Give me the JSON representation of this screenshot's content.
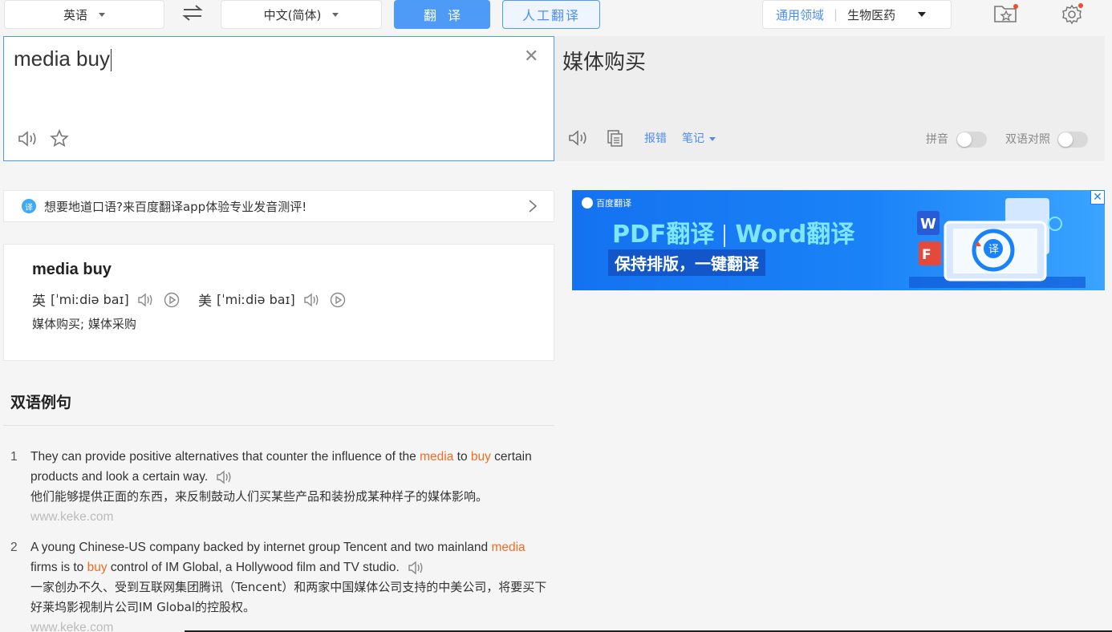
{
  "top_bar": {
    "source_lang": "英语",
    "target_lang": "中文(简体)",
    "translate_button": "翻译",
    "human_translate_button": "人工翻译",
    "domain_general": "通用领域",
    "domain_selected": "生物医药"
  },
  "input": {
    "text": "media buy"
  },
  "output": {
    "text": "媒体购买",
    "report_error": "报错",
    "notes": "笔记",
    "pinyin_label": "拼音",
    "bilingual_label": "双语对照"
  },
  "tip": {
    "text": "想要地道口语?来百度翻译app体验专业发音测评!"
  },
  "ad": {
    "logo_text": "百度翻译",
    "title_pdf": "PDF翻译",
    "title_word": "Word翻译",
    "subtitle": "保持排版，一键翻译",
    "close": "✕"
  },
  "dict": {
    "word": "media buy",
    "uk_label": "英",
    "uk_phonetic": "[ˈmiːdiə baɪ]",
    "us_label": "美",
    "us_phonetic": "[ˈmiːdiə baɪ]",
    "meaning": "媒体购买;  媒体采购"
  },
  "examples": {
    "title": "双语例句",
    "items": [
      {
        "num": "1",
        "en_before": "They can provide positive alternatives that counter the influence of the ",
        "hl1": "media",
        "en_mid": " to ",
        "hl2": "buy",
        "en_after": " certain products and look a certain way.",
        "cn": "他们能够提供正面的东西，来反制鼓动人们买某些产品和装扮成某种样子的媒体影响。",
        "source": "www.keke.com"
      },
      {
        "num": "2",
        "en_before": "A young Chinese-US company backed by internet group Tencent and two mainland ",
        "hl1": "media",
        "en_mid": " firms is to ",
        "hl2": "buy",
        "en_after": " control of IM Global, a Hollywood film and TV studio.",
        "cn": "一家创办不久、受到互联网集团腾讯（Tencent）和两家中国媒体公司支持的中美公司，将要买下好莱坞影视制片公司IM Global的控股权。",
        "source": "www.keke.com"
      }
    ]
  }
}
